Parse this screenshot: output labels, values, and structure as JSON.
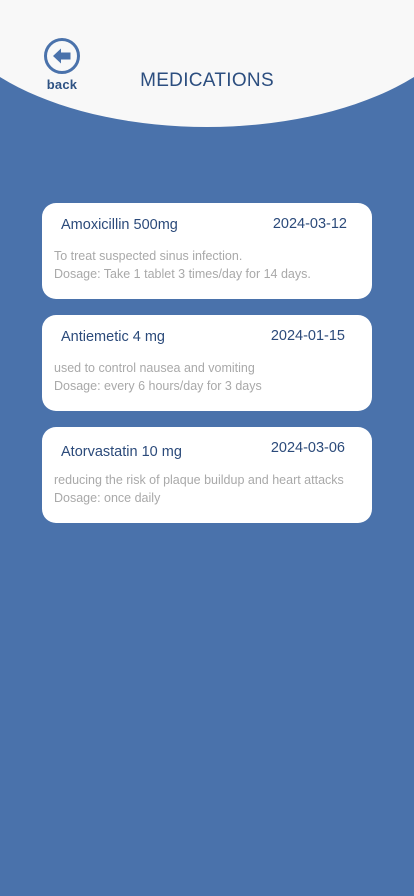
{
  "header": {
    "back_label": "back",
    "title": "MEDICATIONS",
    "back_icon": "arrow-left-circle-icon"
  },
  "colors": {
    "background": "#4a72ab",
    "header": "#f8f8f8",
    "card": "#ffffff",
    "title_text": "#2c4e7f",
    "secondary_text": "#a9a9a9"
  },
  "medications": [
    {
      "name": "Amoxicillin 500mg",
      "date": "2024-03-12",
      "description": "To treat suspected sinus infection.",
      "dosage": "Dosage: Take 1 tablet 3 times/day for 14 days."
    },
    {
      "name": "Antiemetic 4 mg",
      "date": "2024-01-15",
      "description": "used to control nausea and vomiting",
      "dosage": "Dosage: every 6 hours/day for 3 days"
    },
    {
      "name": "Atorvastatin 10 mg",
      "date": "2024-03-06",
      "description": "reducing the risk of plaque buildup and heart attacks",
      "dosage": "Dosage: once daily"
    }
  ]
}
